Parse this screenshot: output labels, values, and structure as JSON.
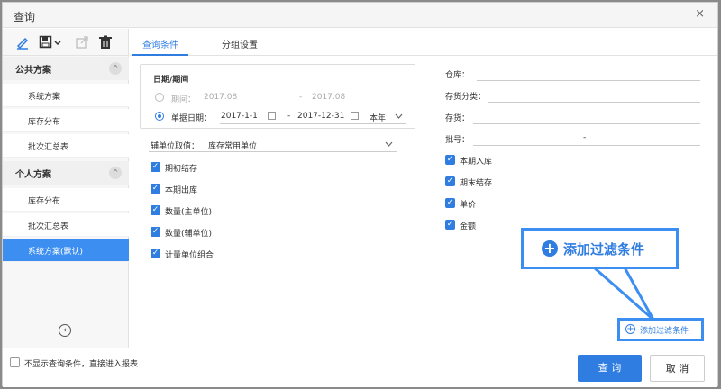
{
  "dialog": {
    "title": "查询",
    "close_glyph": "×"
  },
  "sidebar": {
    "toolbar": [
      "edit-icon",
      "save-icon",
      "export-icon",
      "delete-icon"
    ],
    "public_group": {
      "label": "公共方案",
      "chev": "^"
    },
    "public_items": [
      "系统方案",
      "库存分布",
      "批次汇总表"
    ],
    "personal_group": {
      "label": "个人方案",
      "chev": "^"
    },
    "personal_items": [
      "库存分布",
      "批次汇总表",
      "系统方案(默认)"
    ],
    "collapse_glyph": "‹"
  },
  "tabs": [
    "查询条件",
    "分组设置"
  ],
  "date": {
    "section_label": "日期/期间",
    "period_label": "期间：",
    "period_from": "2017.08",
    "period_to": "2017.08",
    "dash": "-",
    "doc_date_label": "单据日期：",
    "doc_from": "2017-1-1",
    "doc_to": "2017-12-31",
    "preset": "本年"
  },
  "aux_unit": {
    "label": "辅单位取值：",
    "value": "库存常用单位"
  },
  "left_checks": [
    "期初结存",
    "本期出库",
    "数量(主单位)",
    "数量(辅单位)",
    "计量单位组合"
  ],
  "right_fields": {
    "warehouse": "仓库：",
    "inventory_class": "存货分类：",
    "inventory": "存货：",
    "batch": "批号：",
    "batch_dash": "-"
  },
  "right_checks": [
    "本期入库",
    "期末结存",
    "单价",
    "金额"
  ],
  "callout": {
    "plus": "+",
    "text": "添加过滤条件"
  },
  "add_filter": {
    "plus": "+",
    "label": "添加过滤条件"
  },
  "footer": {
    "skip_label": "不显示查询条件，直接进入报表",
    "query_label": "查 询",
    "cancel_label": "取 消"
  },
  "check_glyph": "✓",
  "colors": {
    "accent": "#2f7de1",
    "active_item": "#3c8ef0"
  }
}
